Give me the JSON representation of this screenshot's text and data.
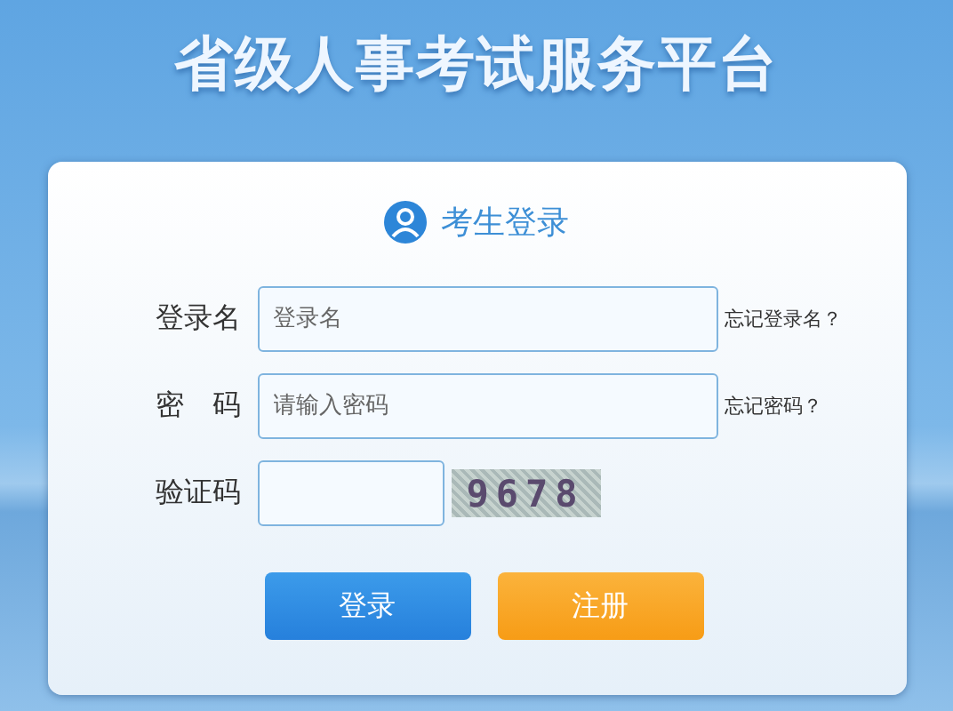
{
  "page_title": "省级人事考试服务平台",
  "login_panel": {
    "heading": "考生登录",
    "fields": [
      {
        "kind": "text",
        "label": "登录名",
        "placeholder": "登录名",
        "link": "忘记登录名？"
      },
      {
        "kind": "password",
        "label": "密　码",
        "placeholder": "请输入密码",
        "link": "忘记密码？"
      },
      {
        "kind": "captcha",
        "label": "验证码",
        "captcha": "9678"
      }
    ],
    "buttons": [
      {
        "kind": "primary",
        "label": "登录"
      },
      {
        "kind": "secondary",
        "label": "注册"
      }
    ]
  }
}
